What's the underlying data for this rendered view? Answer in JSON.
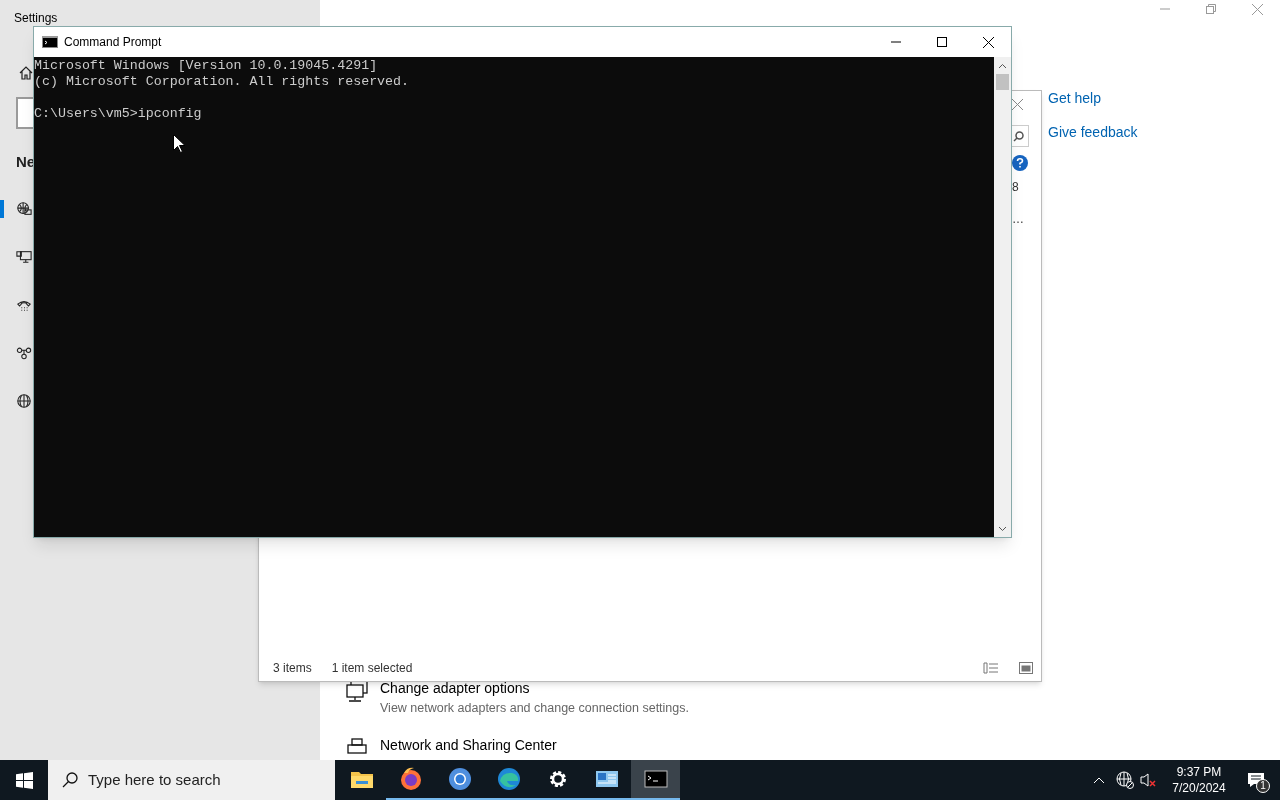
{
  "settings_window": {
    "title": "Settings",
    "nav_heading": "Ne",
    "nav_items": [
      {
        "selected": true
      },
      {
        "selected": false
      },
      {
        "selected": false
      },
      {
        "selected": false
      },
      {
        "selected": false
      }
    ],
    "links": [
      "Get help",
      "Give feedback"
    ],
    "options": [
      {
        "title": "Change adapter options",
        "description": "View network adapters and change connection settings."
      },
      {
        "title": "Network and Sharing Center"
      }
    ]
  },
  "explorer_window": {
    "visible_text": [
      "8",
      "…"
    ],
    "status_bar": [
      "3 items",
      "1 item selected"
    ]
  },
  "cmd_window": {
    "title": "Command Prompt",
    "lines": [
      {
        "kind": "output",
        "text": "Microsoft Windows [Version 10.0.19045.4291]"
      },
      {
        "kind": "output",
        "text": "(c) Microsoft Corporation. All rights reserved."
      },
      {
        "kind": "command",
        "text": "C:\\Users\\vm5>ipconfig"
      }
    ]
  },
  "taskbar": {
    "search_placeholder": "Type here to search",
    "apps": [
      {
        "running": false,
        "selected": false
      },
      {
        "running": true,
        "selected": false
      },
      {
        "running": true,
        "selected": false
      },
      {
        "running": true,
        "selected": false
      },
      {
        "running": true,
        "selected": false
      },
      {
        "running": true,
        "selected": false
      },
      {
        "running": true,
        "selected": true
      }
    ],
    "time": "9:37 PM",
    "date": "7/20/2024",
    "notification_count": "1"
  }
}
